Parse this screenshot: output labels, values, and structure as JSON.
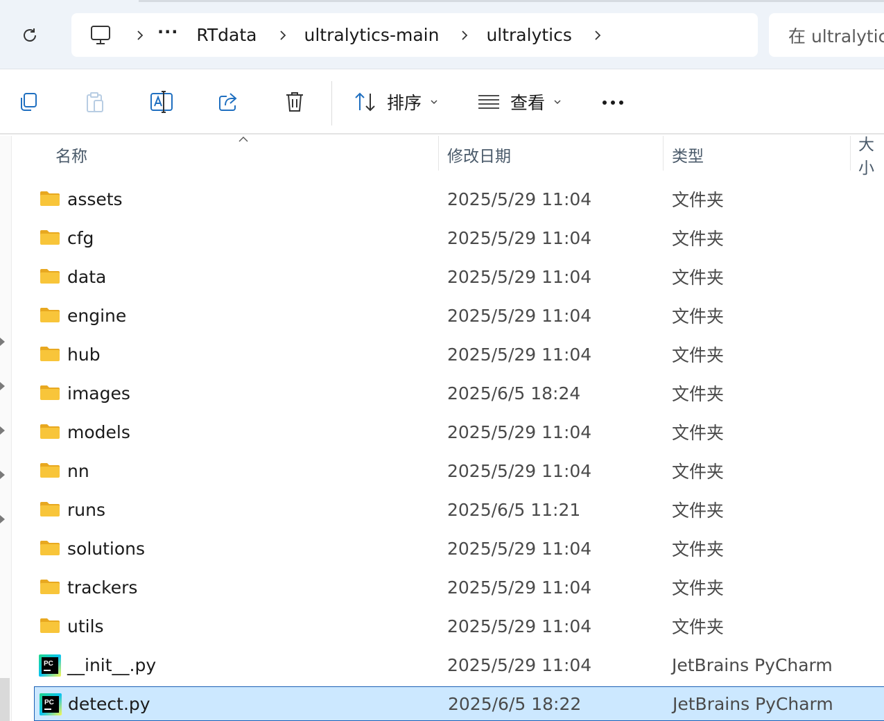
{
  "address_bar": {
    "crumbs": [
      "RTdata",
      "ultralytics-main",
      "ultralytics"
    ],
    "overflow": "···",
    "search_placeholder": "在 ultralytics 中搜索"
  },
  "command_bar": {
    "sort_label": "排序",
    "view_label": "查看"
  },
  "columns": {
    "name": "名称",
    "modified": "修改日期",
    "type": "类型",
    "size": "大小"
  },
  "files": [
    {
      "name": "assets",
      "modified": "2025/5/29 11:04",
      "type": "文件夹",
      "icon": "folder-icon"
    },
    {
      "name": "cfg",
      "modified": "2025/5/29 11:04",
      "type": "文件夹",
      "icon": "folder-icon"
    },
    {
      "name": "data",
      "modified": "2025/5/29 11:04",
      "type": "文件夹",
      "icon": "folder-icon"
    },
    {
      "name": "engine",
      "modified": "2025/5/29 11:04",
      "type": "文件夹",
      "icon": "folder-icon"
    },
    {
      "name": "hub",
      "modified": "2025/5/29 11:04",
      "type": "文件夹",
      "icon": "folder-icon"
    },
    {
      "name": "images",
      "modified": "2025/6/5 18:24",
      "type": "文件夹",
      "icon": "folder-icon"
    },
    {
      "name": "models",
      "modified": "2025/5/29 11:04",
      "type": "文件夹",
      "icon": "folder-icon"
    },
    {
      "name": "nn",
      "modified": "2025/5/29 11:04",
      "type": "文件夹",
      "icon": "folder-icon"
    },
    {
      "name": "runs",
      "modified": "2025/6/5 11:21",
      "type": "文件夹",
      "icon": "folder-icon"
    },
    {
      "name": "solutions",
      "modified": "2025/5/29 11:04",
      "type": "文件夹",
      "icon": "folder-icon"
    },
    {
      "name": "trackers",
      "modified": "2025/5/29 11:04",
      "type": "文件夹",
      "icon": "folder-icon"
    },
    {
      "name": "utils",
      "modified": "2025/5/29 11:04",
      "type": "文件夹",
      "icon": "folder-icon"
    },
    {
      "name": "__init__.py",
      "modified": "2025/5/29 11:04",
      "type": "JetBrains PyCharm",
      "icon": "pycharm-file-icon"
    },
    {
      "name": "detect.py",
      "modified": "2025/6/5 18:22",
      "type": "JetBrains PyCharm",
      "icon": "pycharm-file-icon",
      "selected": true
    }
  ],
  "pycharm_badge": "PC",
  "colors": {
    "selection_bg": "#cce8ff",
    "selection_border": "#1a5fb4",
    "folder": "#f8c53a",
    "accent_blue": "#1f6fc0"
  }
}
